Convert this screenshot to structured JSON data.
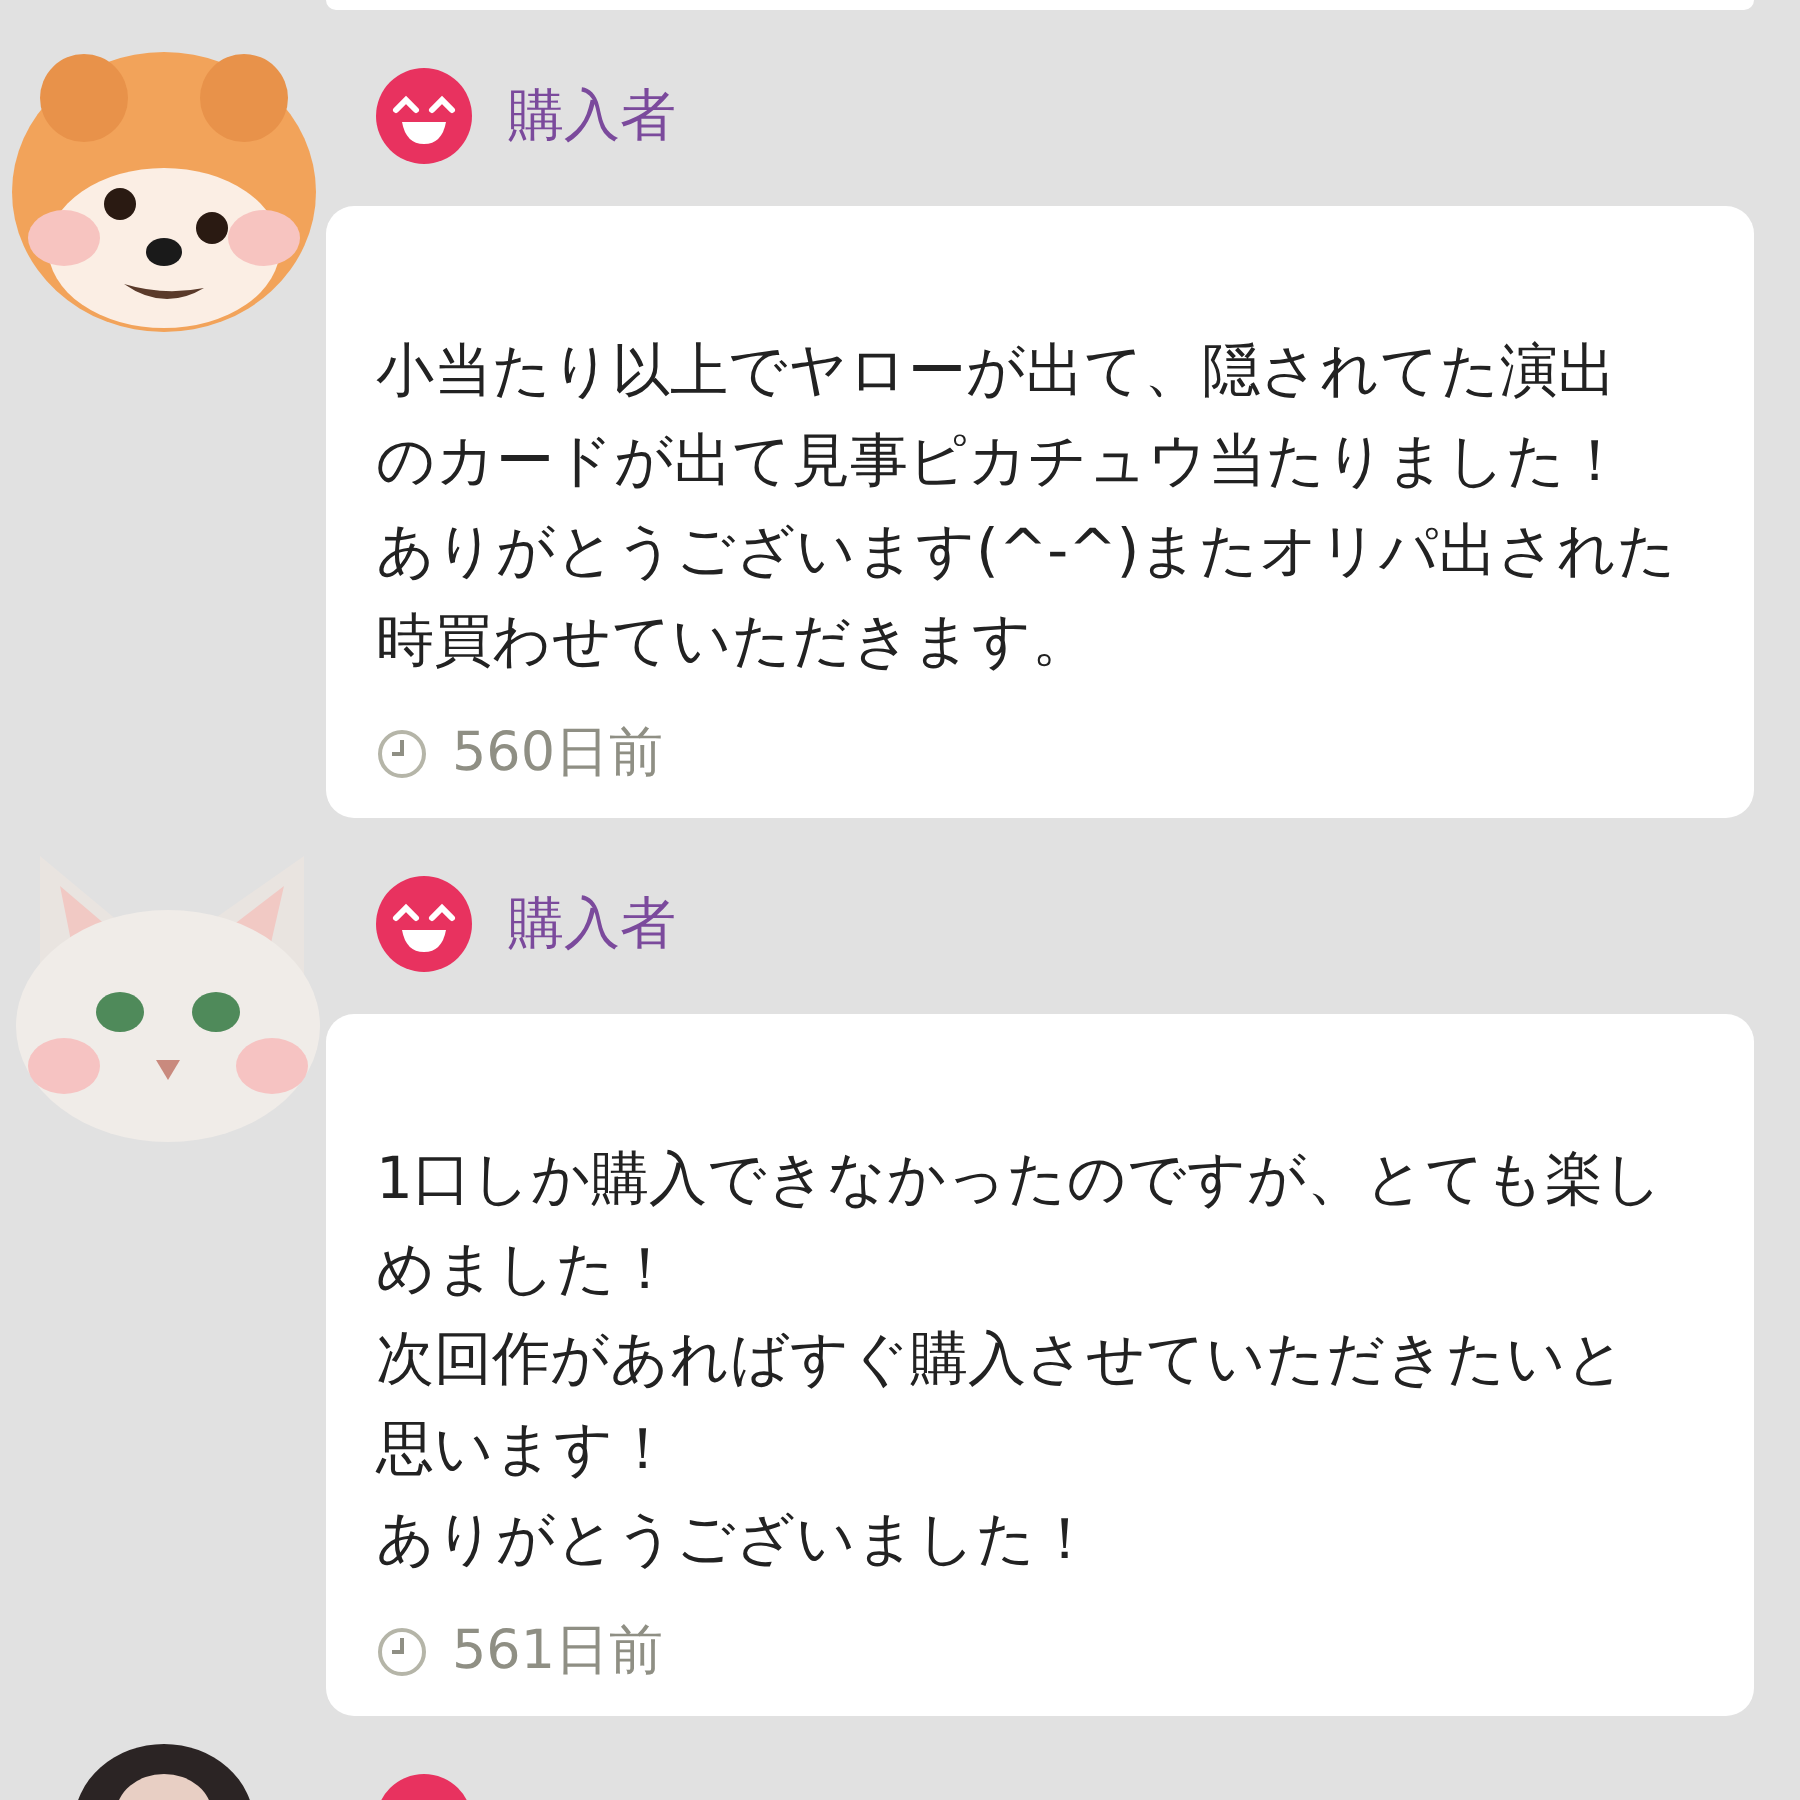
{
  "reviews": [
    {
      "avatar": {
        "kind": "dog"
      },
      "author": "購入者",
      "message": [
        "小当たり以上でヤローが出て、隠されてた演出",
        "のカードが出て見事ピカチュウ当たりました！",
        "ありがとうございます(^-^)またオリパ出された",
        "時買わせていただきます。"
      ],
      "time": "560日前"
    },
    {
      "avatar": {
        "kind": "cat"
      },
      "author": "購入者",
      "message": [
        "1口しか購入できなかったのですが、とても楽し",
        "めました！",
        "次回作があればすぐ購入させていただきたいと",
        "思います！",
        "ありがとうございました！"
      ],
      "time": "561日前"
    },
    {
      "avatar": {
        "kind": "person"
      }
    }
  ]
}
